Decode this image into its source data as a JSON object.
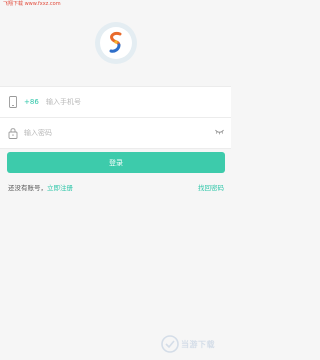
{
  "watermark_top": "飞翔下载 www.fxxz.com",
  "login": {
    "phone_prefix": "+86",
    "phone_placeholder": "输入手机号",
    "password_placeholder": "输入密码",
    "submit_label": "登录",
    "no_account_text": "还没有账号，",
    "register_link": "立即注册",
    "forgot_link": "找回密码"
  },
  "watermark_bottom": "当游下载",
  "icons": [
    "app-logo-icon",
    "phone-icon",
    "lock-icon",
    "eye-closed-icon"
  ],
  "colors": {
    "accent": "#3dcbab",
    "link": "#2cc6a8",
    "background": "#f6f6f6"
  }
}
